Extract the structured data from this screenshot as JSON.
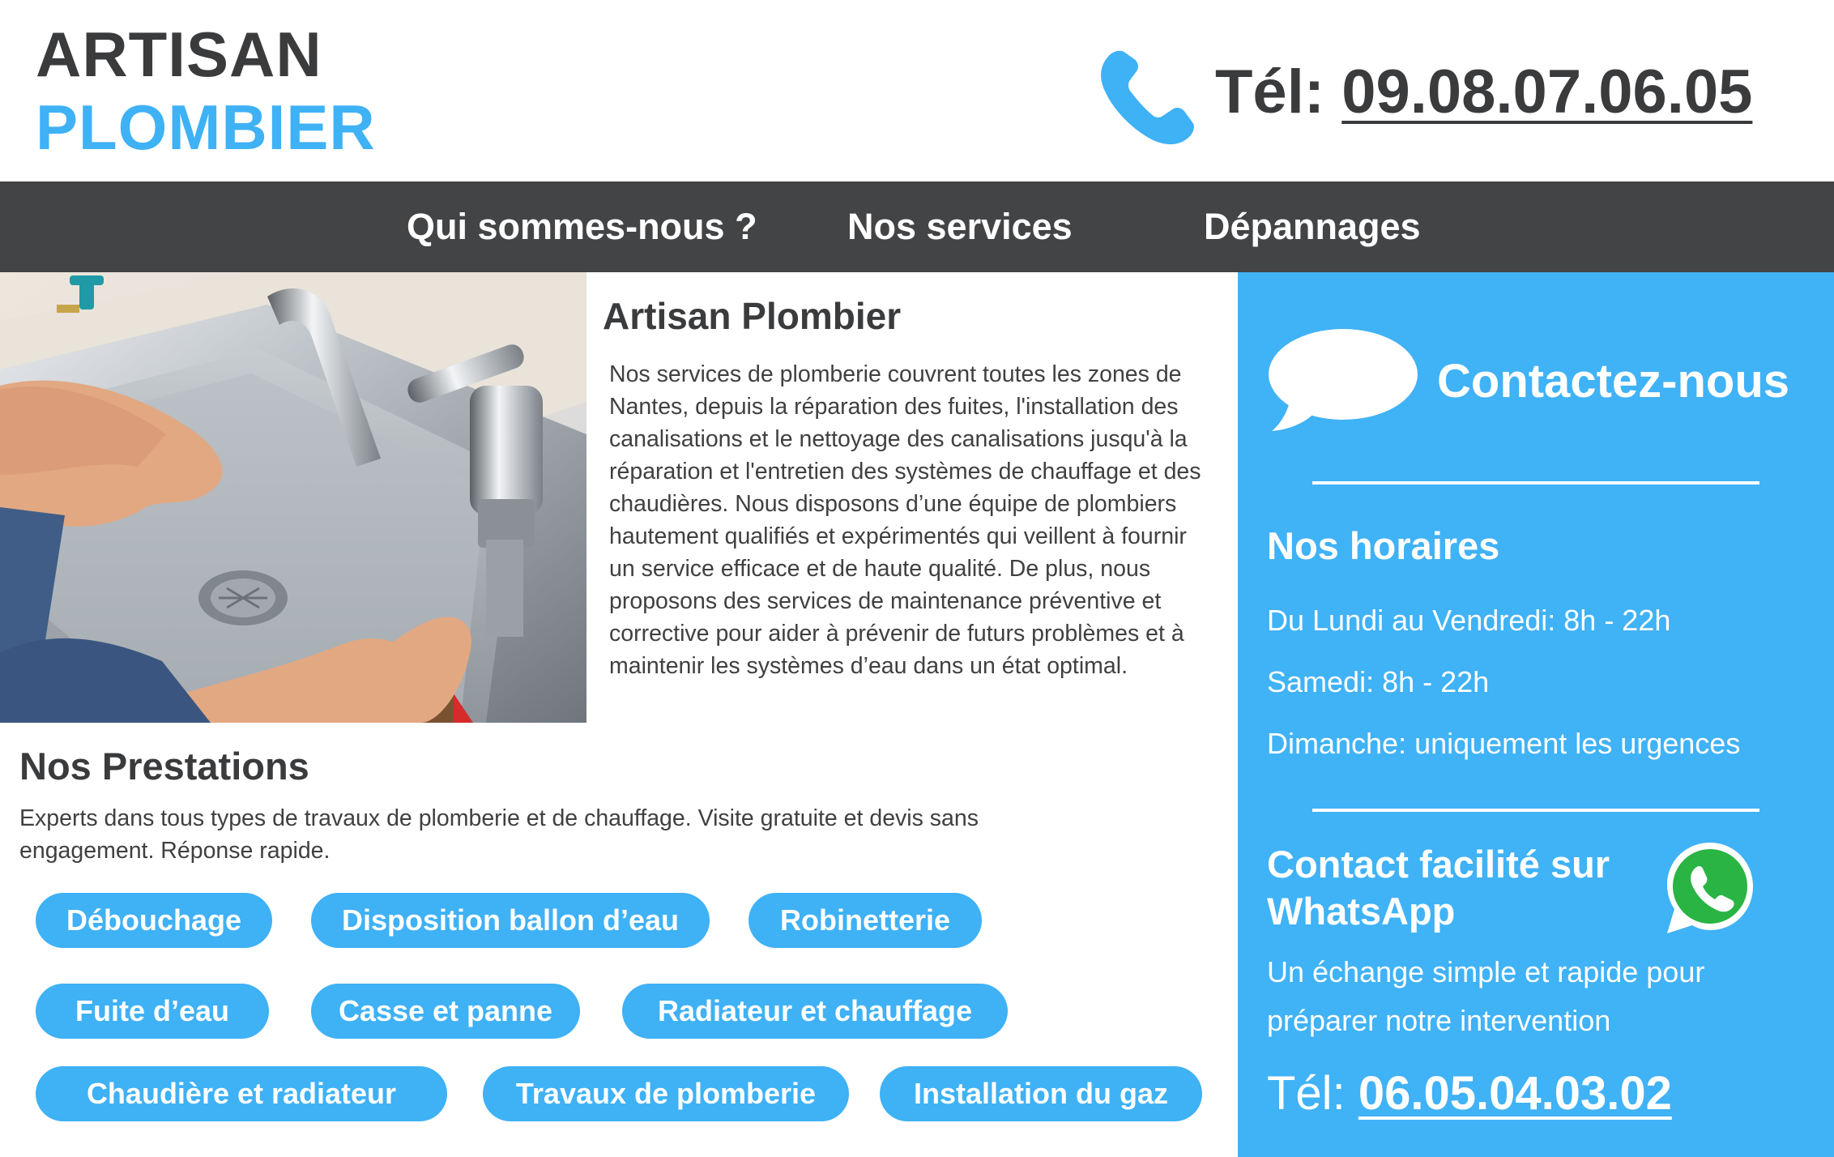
{
  "brand": {
    "line1": "ARTISAN",
    "line2": "PLOMBIER",
    "accent_color": "#3fb1f5",
    "dark_color": "#3a3b3d"
  },
  "header": {
    "tel_label": "Tél:",
    "tel_number": "09.08.07.06.05",
    "icon": "phone-icon"
  },
  "nav": {
    "items": [
      {
        "label": "Qui sommes-nous ?"
      },
      {
        "label": "Nos services"
      },
      {
        "label": "Dépannages"
      }
    ],
    "background": "#434446"
  },
  "intro": {
    "title": "Artisan Plombier",
    "text": "Nos services de plomberie couvrent toutes les zones de Nantes, depuis la réparation des fuites, l'installation des canalisations et le nettoyage des canalisations jusqu'à la réparation et l'entretien des systèmes de chauffage et des chaudières. Nous disposons d’une équipe de plombiers hautement qualifiés et expérimentés qui veillent à fournir un service efficace et de haute qualité. De plus, nous proposons des services de maintenance préventive et corrective pour aider à prévenir de futurs problèmes et à maintenir les systèmes d’eau dans un état optimal."
  },
  "prestations": {
    "title": "Nos Prestations",
    "text": "Experts dans tous types de travaux de plomberie et de chauffage. Visite gratuite et devis sans engagement. Réponse rapide.",
    "tags": [
      "Débouchage",
      "Disposition ballon d’eau",
      "Robinetterie",
      "Fuite d’eau",
      "Casse et panne",
      "Radiateur et chauffage",
      "Chaudière et radiateur",
      "Travaux de plomberie",
      "Installation du gaz"
    ]
  },
  "sidebar": {
    "background": "#40b2f6",
    "contact_title": "Contactez-nous",
    "contact_icon": "speech-bubble-icon",
    "hours_title": "Nos horaires",
    "hours": [
      "Du Lundi au Vendredi: 8h - 22h",
      "Samedi: 8h - 22h",
      "Dimanche: uniquement les urgences"
    ],
    "whatsapp_title": "Contact facilité sur WhatsApp",
    "whatsapp_icon": "whatsapp-icon",
    "whatsapp_text": "Un échange simple et rapide pour préparer notre intervention",
    "tel_label": "Tél:",
    "tel_number": "06.05.04.03.02"
  }
}
